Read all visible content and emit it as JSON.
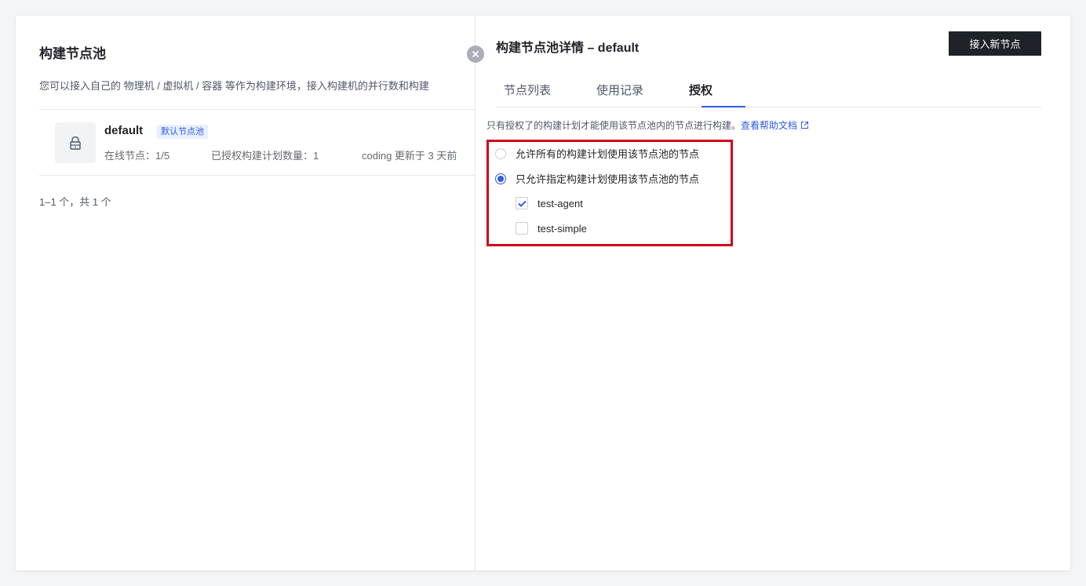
{
  "left": {
    "title": "构建节点池",
    "description": "您可以接入自己的 物理机 / 虚拟机 / 容器 等作为构建环境，接入构建机的并行数和构建",
    "pool": {
      "name": "default",
      "badge": "默认节点池",
      "online_nodes": "在线节点：1/5",
      "authorized_plans": "已授权构建计划数量：1",
      "updated": "coding 更新于 3 天前"
    },
    "pagination": "1–1 个，共 1 个"
  },
  "right": {
    "title": "构建节点池详情 – default",
    "join_button": "接入新节点",
    "tabs": [
      {
        "label": "节点列表",
        "active": false
      },
      {
        "label": "使用记录",
        "active": false
      },
      {
        "label": "授权",
        "active": true
      }
    ],
    "note": "只有授权了的构建计划才能使用该节点池内的节点进行构建。",
    "help_link": "查看帮助文档",
    "options": {
      "allow_all": {
        "label": "允许所有的构建计划使用该节点池的节点",
        "selected": false
      },
      "allow_specific": {
        "label": "只允许指定构建计划使用该节点池的节点",
        "selected": true
      }
    },
    "plans": [
      {
        "label": "test-agent",
        "checked": true
      },
      {
        "label": "test-simple",
        "checked": false
      }
    ]
  },
  "colors": {
    "accent": "#2e5ce6",
    "highlight": "#d0021b",
    "button_bg": "#1f2329"
  },
  "icons": [
    "lock-icon",
    "close-icon",
    "external-link-icon",
    "check-icon"
  ]
}
